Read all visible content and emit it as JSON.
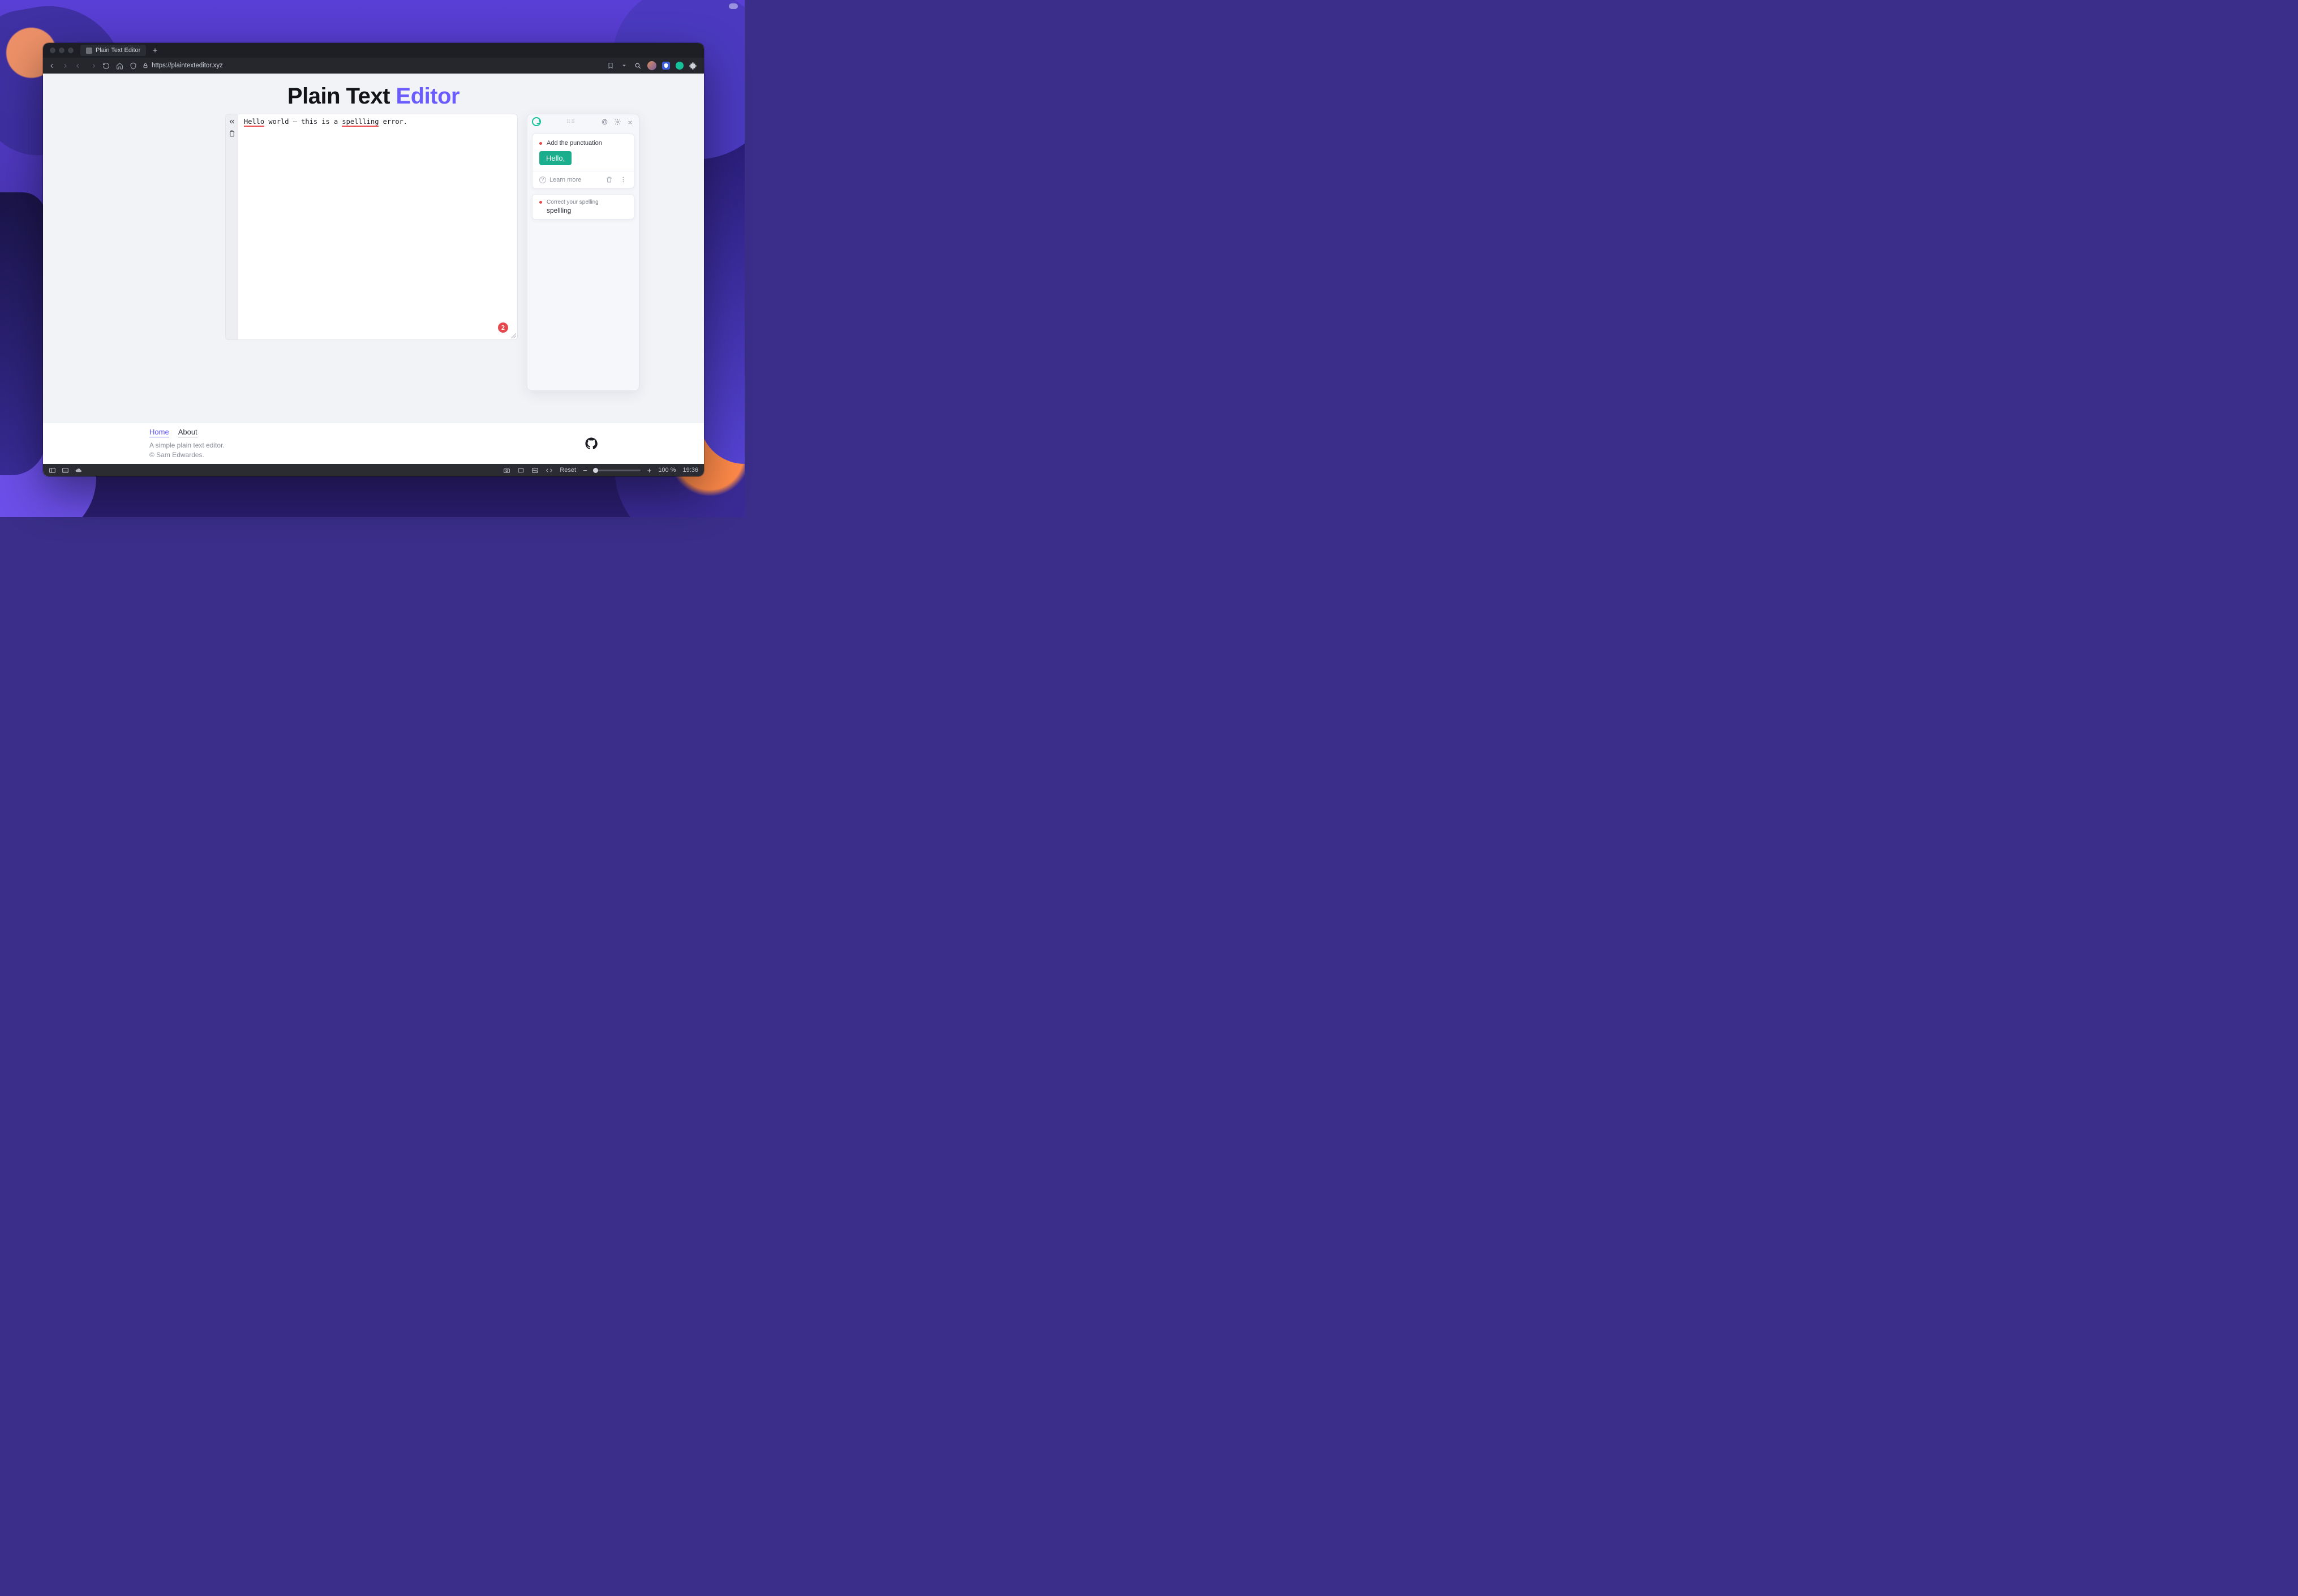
{
  "menubar": {},
  "browser": {
    "tab_title": "Plain Text Editor",
    "url": "https://plaintexteditor.xyz"
  },
  "page": {
    "title_plain": "Plain Text ",
    "title_accent": "Editor",
    "editor_text": {
      "word1": "Hello",
      "seg1": " world — this is a ",
      "word2": "spellling",
      "seg2": " error."
    },
    "error_count": "2"
  },
  "grammarly": {
    "card1": {
      "title": "Add the punctuation",
      "suggestion": "Hello,",
      "learn_more": "Learn more"
    },
    "card2": {
      "title": "Correct your spelling",
      "word": "spellling"
    }
  },
  "footer": {
    "link_home": "Home",
    "link_about": "About",
    "tagline": "A simple plain text editor.",
    "copyright": "© Sam Edwardes."
  },
  "statusbar": {
    "reset": "Reset",
    "zoom": "100 %",
    "time": "19:36"
  }
}
